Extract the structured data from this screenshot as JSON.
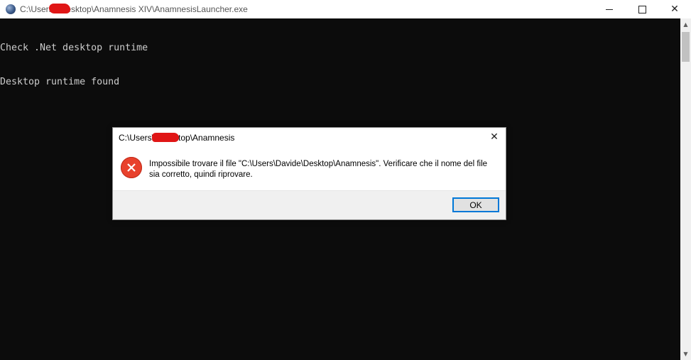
{
  "window": {
    "title": "C:\\Users\\        \\Desktop\\Anamnesis XIV\\AnamnesisLauncher.exe",
    "icon": "console-app-icon"
  },
  "console": {
    "lines": [
      "Check .Net desktop runtime",
      "Desktop runtime found"
    ]
  },
  "dialog": {
    "title": "C:\\Users\\         \\Desktop\\Anamnesis",
    "message_line1": "Impossibile trovare il file \"C:\\Users\\Davide\\Desktop\\Anamnesis\". Verificare che il nome del file",
    "message_line2": "sia corretto, quindi riprovare.",
    "icon": "error-icon",
    "ok_label": "OK"
  },
  "colors": {
    "console_bg": "#0c0c0c",
    "console_text": "#cccccc",
    "error_red": "#e8412c",
    "focus_blue": "#0078d7"
  }
}
